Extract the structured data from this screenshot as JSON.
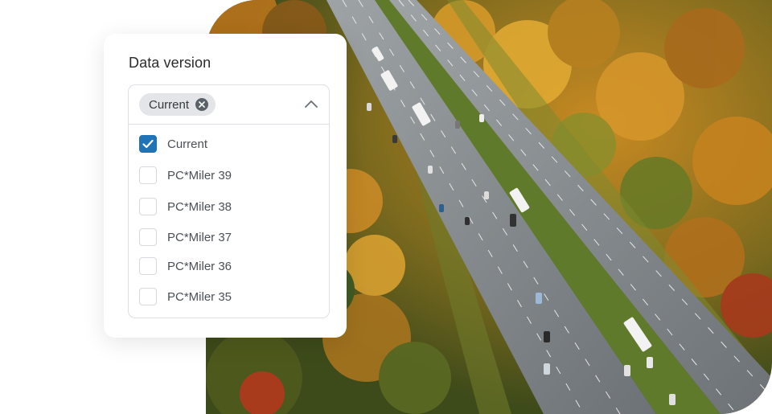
{
  "card": {
    "title": "Data version",
    "selected_chip": "Current",
    "options": [
      {
        "label": "Current",
        "checked": true
      },
      {
        "label": "PC*Miler 39",
        "checked": false
      },
      {
        "label": "PC*Miler 38",
        "checked": false
      },
      {
        "label": "PC*Miler 37",
        "checked": false
      },
      {
        "label": "PC*Miler 36",
        "checked": false
      },
      {
        "label": "PC*Miler 35",
        "checked": false
      }
    ]
  },
  "colors": {
    "accent": "#1f73b7",
    "chip_bg": "#e3e5e8",
    "border": "#dcdfe3"
  },
  "icons": {
    "chip_remove": "close-circle-icon",
    "toggle": "chevron-up-icon",
    "checkbox_checked": "checkmark-icon"
  }
}
